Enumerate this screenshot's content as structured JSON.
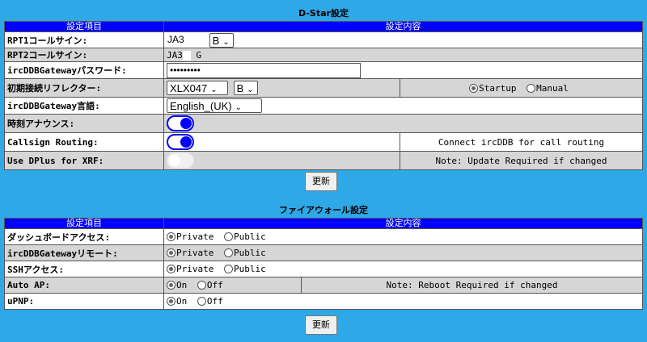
{
  "dstar": {
    "title": "D-Star設定",
    "headers": [
      "設定項目",
      "設定内容"
    ],
    "rpt1": {
      "label": "RPT1コールサイン:",
      "callsign": "JA3",
      "module": "B"
    },
    "rpt2": {
      "label": "RPT2コールサイン:",
      "callsign": "JA3",
      "suffix": "G"
    },
    "password": {
      "label": "ircDDBGatewayパスワード:",
      "value": "•••••••••"
    },
    "reflector": {
      "label": "初期接続リフレクター:",
      "reflector": "XLX047",
      "module": "B",
      "options": [
        "Startup",
        "Manual"
      ],
      "selected": "Startup"
    },
    "language": {
      "label": "ircDDBGateway言語:",
      "value": "English_(UK)"
    },
    "time_announce": {
      "label": "時刻アナウンス:",
      "enabled": true
    },
    "callsign_routing": {
      "label": "Callsign Routing:",
      "enabled": true,
      "note": "Connect ircDDB for call routing"
    },
    "dplus": {
      "label": "Use DPlus for XRF:",
      "enabled": false,
      "note": "Note: Update Required if changed"
    },
    "apply_label": "更新"
  },
  "firewall": {
    "title": "ファイアウォール設定",
    "headers": [
      "設定項目",
      "設定内容"
    ],
    "dashboard": {
      "label": "ダッシュボードアクセス:",
      "options": [
        "Private",
        "Public"
      ],
      "selected": "Private"
    },
    "ircddb_remote": {
      "label": "ircDDBGatewayリモート:",
      "options": [
        "Private",
        "Public"
      ],
      "selected": "Private"
    },
    "ssh": {
      "label": "SSHアクセス:",
      "options": [
        "Private",
        "Public"
      ],
      "selected": "Private"
    },
    "auto_ap": {
      "label": "Auto AP:",
      "options": [
        "On",
        "Off"
      ],
      "selected": "On",
      "note": "Note: Reboot Required if changed"
    },
    "upnp": {
      "label": "uPNP:",
      "options": [
        "On",
        "Off"
      ],
      "selected": "On"
    },
    "apply_label": "更新"
  },
  "colors": {
    "background": "#2ea8e6",
    "header": "#0000ff",
    "toggle_on": "#0000ff"
  }
}
